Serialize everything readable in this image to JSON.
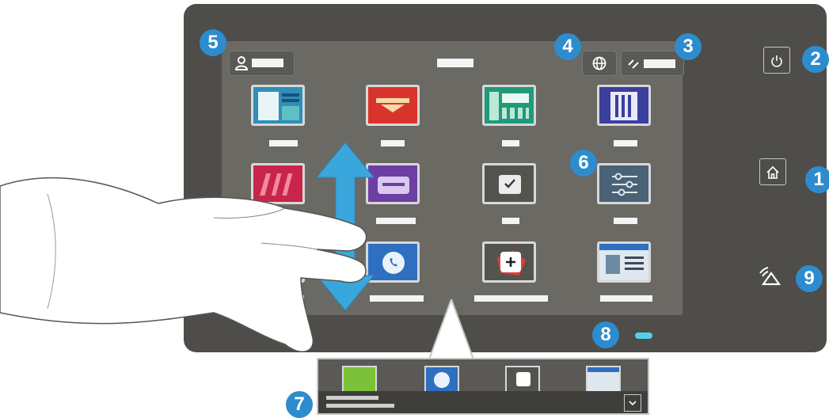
{
  "callouts": {
    "home": "1",
    "power": "2",
    "reset": "3",
    "language": "4",
    "login": "5",
    "app_tile": "6",
    "notification_banner": "7",
    "status_led": "8",
    "nfc": "9"
  },
  "colors": {
    "panel": "#4e4d49",
    "screen": "#6a6964",
    "badge": "#2d8ccd",
    "status_led": "#4fd4e6",
    "arrow": "#3aa7dc"
  },
  "icons": {
    "home": "home-icon",
    "power": "power-icon",
    "reset": "reset-icon",
    "language": "globe-icon",
    "login": "user-icon",
    "nfc": "nfc-icon",
    "chevron": "chevron-down-icon"
  }
}
